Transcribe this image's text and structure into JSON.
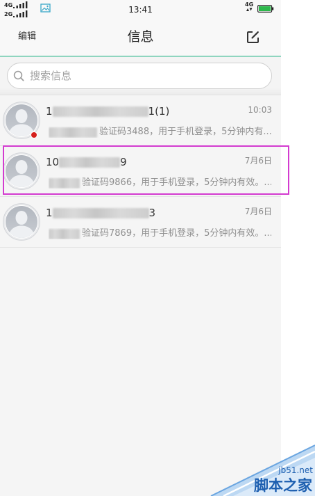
{
  "status_bar": {
    "sim1_network": "4G",
    "sim2_network": "2G",
    "time": "13:41",
    "data_network": "4G",
    "battery_color": "#2db84b",
    "icons": [
      "signal-icon",
      "gallery-icon",
      "data-arrows-icon",
      "battery-icon"
    ]
  },
  "header": {
    "edit_label": "编辑",
    "title": "信息",
    "compose_icon": "compose-icon",
    "accent_color": "#8fd5bf"
  },
  "search": {
    "placeholder": "搜索信息",
    "icon": "search-icon"
  },
  "conversations": [
    {
      "name_prefix": "1",
      "name_suffix": "1(1)",
      "time": "10:03",
      "preview": "验证码3488，用于手机登录，5分钟内有...",
      "unread": true,
      "highlighted": false
    },
    {
      "name_prefix": "10",
      "name_suffix": "9",
      "time": "7月6日",
      "preview": "验证码9866，用于手机登录，5分钟内有效。...",
      "unread": false,
      "highlighted": true
    },
    {
      "name_prefix": "1",
      "name_suffix": "3",
      "time": "7月6日",
      "preview": "验证码7869，用于手机登录，5分钟内有效。...",
      "unread": false,
      "highlighted": false
    }
  ],
  "colors": {
    "unread_dot": "#d5201c",
    "highlight_border": "#d33bd0",
    "watermark_blue": "#1d5fb0"
  },
  "watermark": {
    "site": "jb51.net",
    "name": "脚本之家"
  }
}
